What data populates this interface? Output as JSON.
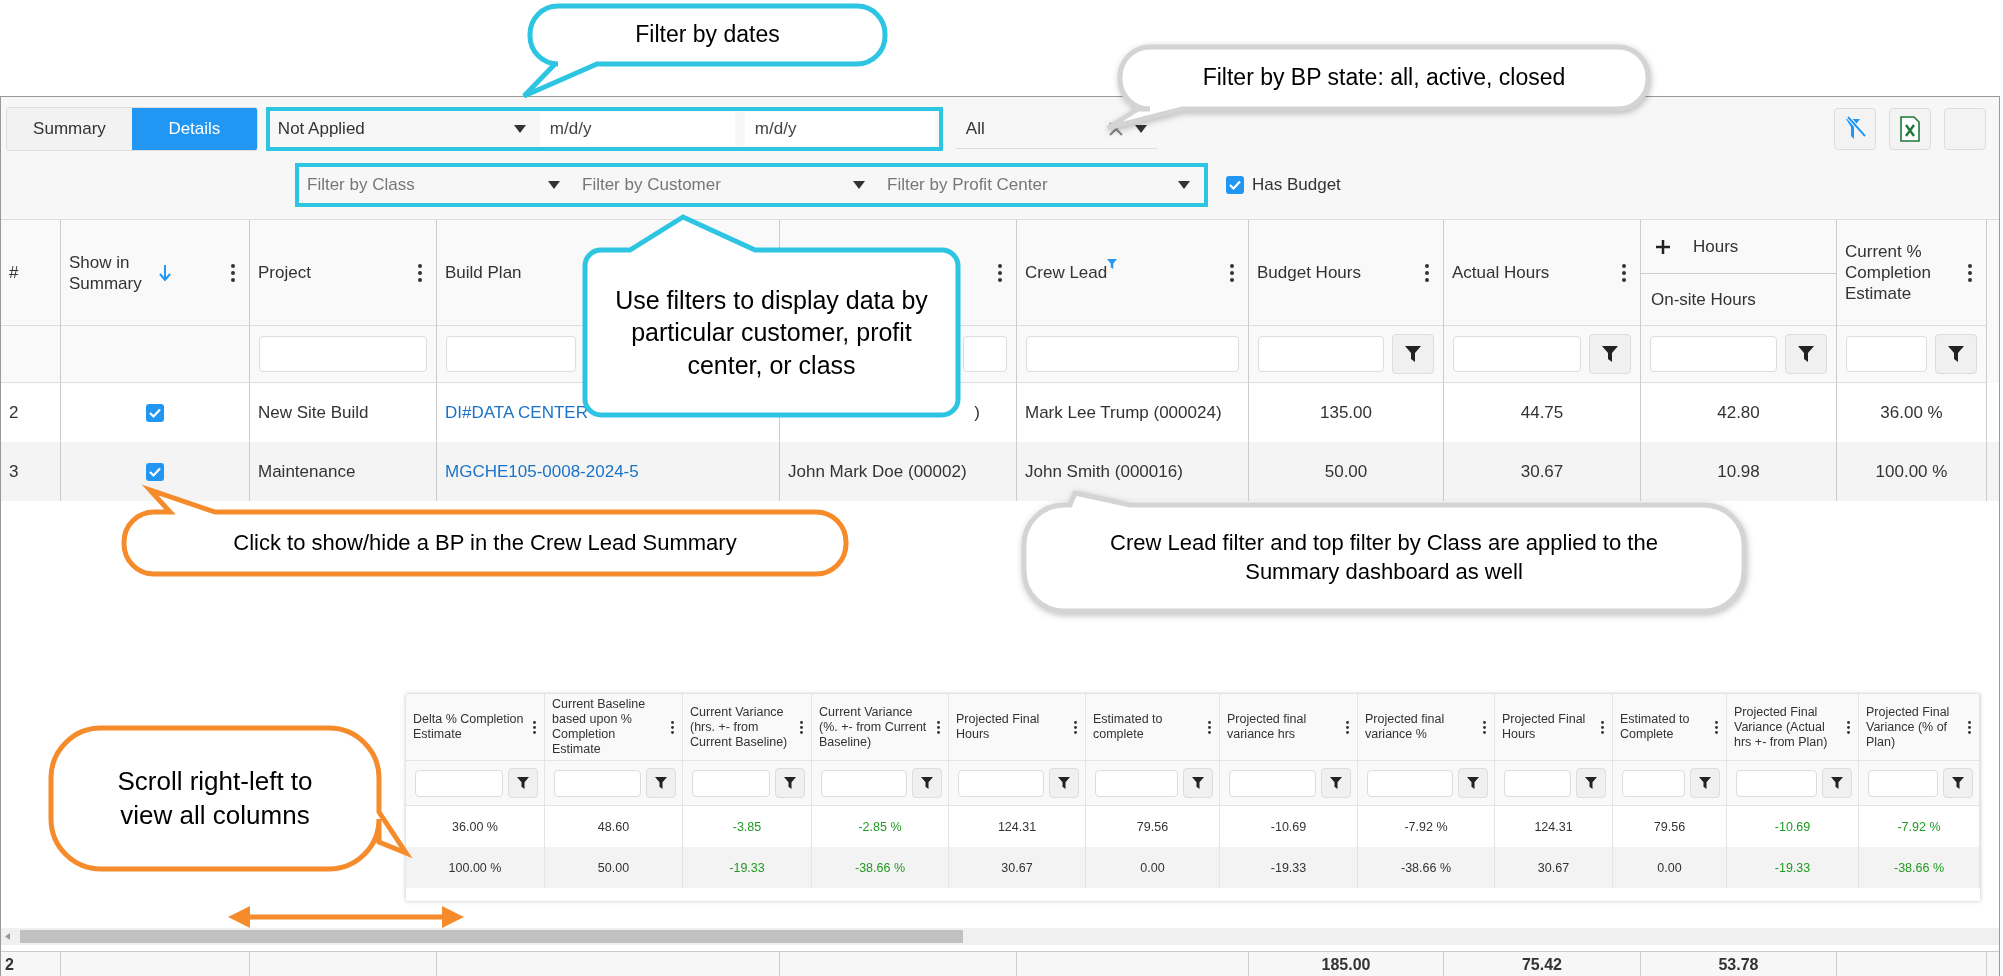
{
  "view_tabs": [
    {
      "label": "Summary",
      "selected": false
    },
    {
      "label": "Details",
      "selected": true
    }
  ],
  "date_filter": {
    "range": "Not Applied",
    "from_placeholder": "m/d/y",
    "to_placeholder": "m/d/y"
  },
  "state_filter": {
    "value": "All"
  },
  "scope_filters": [
    {
      "placeholder": "Filter by Class"
    },
    {
      "placeholder": "Filter by Customer"
    },
    {
      "placeholder": "Filter by Profit Center"
    }
  ],
  "has_budget": {
    "label": "Has Budget",
    "checked": true
  },
  "table": {
    "columns": [
      {
        "label": "#",
        "kind": "index",
        "sorted": false,
        "filter_active": false,
        "filter_input": false,
        "filter_button": false
      },
      {
        "label": "Show in Summary",
        "kind": "check",
        "sorted": true,
        "filter_active": false,
        "filter_input": false,
        "filter_button": false
      },
      {
        "label": "Project",
        "kind": "text",
        "sorted": false,
        "filter_active": false,
        "filter_input": true,
        "filter_button": false
      },
      {
        "label": "Build Plan",
        "kind": "link",
        "sorted": false,
        "filter_active": false,
        "filter_input": true,
        "filter_button": false
      },
      {
        "kind": "text",
        "sorted": false,
        "filter_active": false,
        "filter_input": true,
        "filter_button": false
      },
      {
        "label": "Crew Lead",
        "kind": "text",
        "sorted": false,
        "filter_active": true,
        "filter_input": true,
        "filter_button": false
      },
      {
        "label": "Budget Hours",
        "kind": "numeric",
        "sorted": false,
        "filter_active": false,
        "filter_input": true,
        "filter_button": true
      },
      {
        "label": "Actual Hours",
        "kind": "numeric",
        "sorted": false,
        "filter_active": false,
        "filter_input": true,
        "filter_button": true
      },
      {
        "group": "Hours",
        "label": "On-site Hours",
        "kind": "numeric",
        "sorted": false,
        "filter_active": false,
        "filter_input": true,
        "filter_button": true
      },
      {
        "label": "Current % Completion Estimate",
        "kind": "numeric",
        "sorted": false,
        "filter_active": false,
        "filter_input": true,
        "filter_button": true
      }
    ],
    "rows": [
      {
        "show_in_summary": true,
        "cells": [
          "2",
          "",
          "New Site Build",
          "DI#DATA CENTER",
          ")",
          "Mark Lee Trump (000024)",
          "135.00",
          "44.75",
          "42.80",
          "36.00 %"
        ]
      },
      {
        "show_in_summary": true,
        "cells": [
          "3",
          "",
          "Maintenance",
          "MGCHE105-0008-2024-5",
          "John Mark Doe (00002)",
          "John Smith (000016)",
          "50.00",
          "30.67",
          "10.98",
          "100.00 %"
        ]
      }
    ],
    "footer": {
      "count": "2",
      "totals": [
        "185.00",
        "75.42",
        "53.78"
      ]
    }
  },
  "extra_columns": {
    "columns": [
      {
        "label": "Delta % Completion Estimate",
        "kind": "plain"
      },
      {
        "label": "Current Baseline based upon % Completion Estimate",
        "kind": "plain"
      },
      {
        "label": "Current Variance (hrs. +- from Current Baseline)",
        "kind": "variance"
      },
      {
        "label": "Current Variance (%. +- from Current Baseline)",
        "kind": "variance"
      },
      {
        "label": "Projected Final Hours",
        "kind": "plain"
      },
      {
        "label": "Estimated to complete",
        "kind": "plain"
      },
      {
        "label": "Projected final variance hrs",
        "kind": "plain"
      },
      {
        "label": "Projected final variance %",
        "kind": "plain"
      },
      {
        "label": "Projected Final Hours",
        "kind": "plain"
      },
      {
        "label": "Estimated to Complete",
        "kind": "plain"
      },
      {
        "label": "Projected Final Variance (Actual hrs +- from Plan)",
        "kind": "variance"
      },
      {
        "label": "Projected Final Variance (% of Plan)",
        "kind": "variance"
      }
    ],
    "rows": [
      [
        "36.00 %",
        "48.60",
        "-3.85",
        "-2.85 %",
        "124.31",
        "79.56",
        "-10.69",
        "-7.92 %",
        "124.31",
        "79.56",
        "-10.69",
        "-7.92 %"
      ],
      [
        "100.00 %",
        "50.00",
        "-19.33",
        "-38.66 %",
        "30.67",
        "0.00",
        "-19.33",
        "-38.66 %",
        "30.67",
        "0.00",
        "-19.33",
        "-38.66 %"
      ]
    ]
  },
  "callouts": [
    {
      "text": "Filter by dates",
      "color": "#2ec5e2"
    },
    {
      "text": "Filter by BP state: all, active, closed",
      "color": "#d4d4d4"
    },
    {
      "text": "Use filters to display data by particular customer, profit center, or class",
      "color": "#2ec5e2"
    },
    {
      "text": "Click to show/hide a BP in the Crew Lead Summary",
      "color": "#f68b2b"
    },
    {
      "text": "Crew Lead filter and top filter by Class are applied to the Summary dashboard as well",
      "color": "#d4d4d4"
    },
    {
      "text": "Scroll right-left to view all columns",
      "color": "#f68b2b"
    }
  ]
}
